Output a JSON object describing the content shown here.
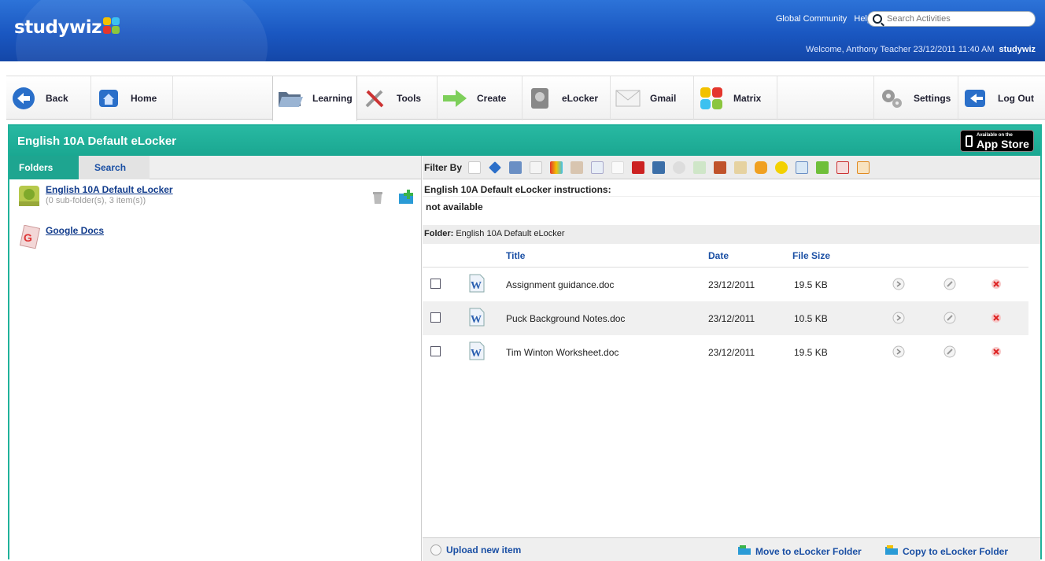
{
  "app": {
    "logo_text": "studywiz",
    "brand_colors": {
      "header_blue": "#1a57c1",
      "panel_teal": "#1fb09a",
      "link_blue": "#1a4fa4"
    }
  },
  "header": {
    "links": [
      "Global Community",
      "Help"
    ],
    "search_placeholder": "Search Activities",
    "welcome": "Welcome, Anthony Teacher  23/12/2011 11:40 AM",
    "mini_logo": "studywiz"
  },
  "toolbar": {
    "back": "Back",
    "home": "Home",
    "learning": "Learning",
    "tools": "Tools",
    "create": "Create",
    "elocker": "eLocker",
    "gmail": "Gmail",
    "matrix": "Matrix",
    "settings": "Settings",
    "logout": "Log Out"
  },
  "panel": {
    "title": "English 10A Default eLocker",
    "appstore_line1": "Available on the",
    "appstore_line2": "App Store"
  },
  "left": {
    "tabs": [
      "Folders",
      "Search"
    ],
    "folders": [
      {
        "name": "English 10A Default eLocker",
        "sub": "(0 sub-folder(s), 3 item(s))"
      },
      {
        "name": "Google Docs",
        "sub": ""
      }
    ]
  },
  "right": {
    "filter_label": "Filter By",
    "filter_icons": [
      "file-icon",
      "diamond-icon",
      "printer-icon",
      "page-icon",
      "colors-icon",
      "music-icon",
      "image-icon",
      "text-icon",
      "calendar-icon",
      "photo-icon",
      "gamepad-icon",
      "check-icon",
      "basket-icon",
      "pen-icon",
      "mail-icon",
      "smiley-icon",
      "list-icon",
      "ebook-icon",
      "pdf-icon",
      "ppt-icon"
    ],
    "instructions_title": "English 10A Default eLocker instructions:",
    "instructions_body": "not available",
    "folder_label": "Folder:",
    "folder_name": "English 10A Default eLocker",
    "columns": {
      "title": "Title",
      "date": "Date",
      "size": "File Size"
    },
    "files": [
      {
        "title": "Assignment guidance.doc",
        "date": "23/12/2011",
        "size": "19.5 KB"
      },
      {
        "title": "Puck Background Notes.doc",
        "date": "23/12/2011",
        "size": "10.5 KB"
      },
      {
        "title": "Tim Winton Worksheet.doc",
        "date": "23/12/2011",
        "size": "19.5 KB"
      }
    ],
    "upload": "Upload new item",
    "move": "Move to eLocker Folder",
    "copy": "Copy to eLocker Folder"
  }
}
